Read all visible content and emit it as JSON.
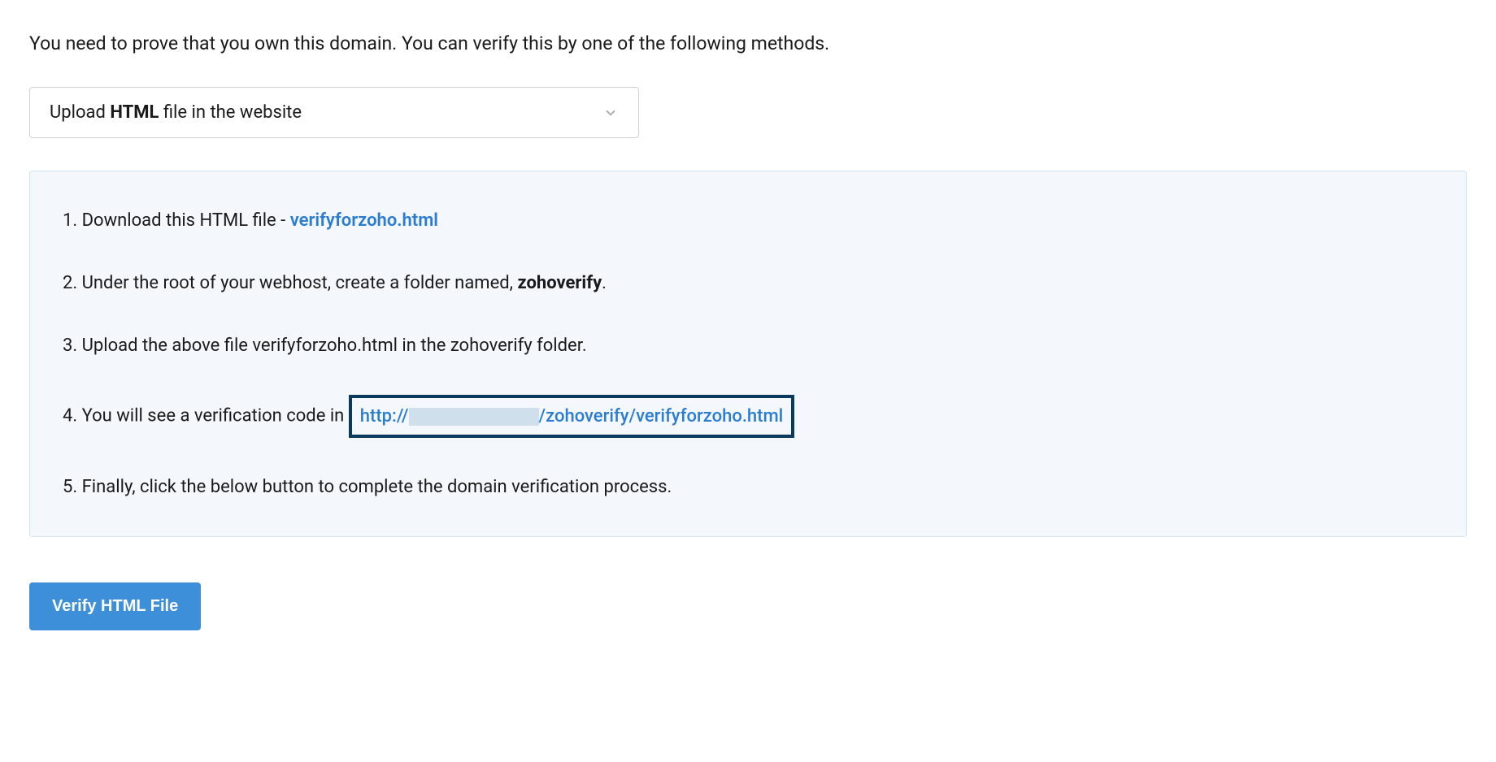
{
  "intro": "You need to prove that you own this domain. You can verify this by one of the following methods.",
  "dropdown": {
    "prefix": "Upload ",
    "bold": "HTML",
    "suffix": " file in the website"
  },
  "instructions": {
    "step1_prefix": "1. Download this HTML file - ",
    "step1_link": "verifyforzoho.html",
    "step2_prefix": "2. Under the root of your webhost, create a folder named, ",
    "step2_bold": "zohoverify",
    "step2_suffix": ".",
    "step3": "3. Upload the above file verifyforzoho.html in the zohoverify folder.",
    "step4_prefix": "4. You will see a verification code in ",
    "step4_url_prefix": "http://",
    "step4_url_suffix": "/zohoverify/verifyforzoho.html",
    "step5": "5. Finally, click the below button to complete the domain verification process."
  },
  "button": {
    "label": "Verify HTML File"
  }
}
